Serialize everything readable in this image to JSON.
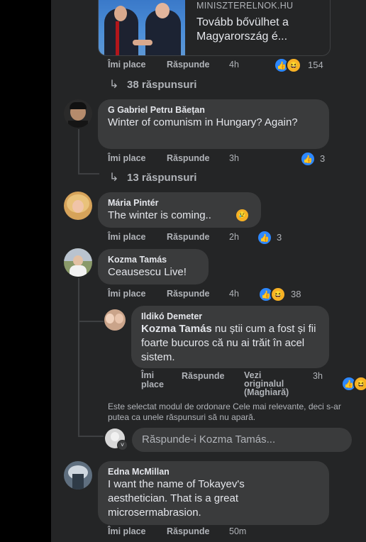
{
  "link_card": {
    "domain": "MINISZTERELNOK.HU",
    "title": "Tovább bővülhet a Magyarország é..."
  },
  "actions": {
    "like": "Îmi place",
    "reply": "Răspunde"
  },
  "comments": [
    {
      "time": "4h",
      "reactions": "154",
      "replies_label": "38 răspunsuri"
    },
    {
      "name": "G Gabriel Petru Băețan",
      "text": "Winter of comunism in Hungary? Again?",
      "time": "3h",
      "reactions": "3",
      "replies_label": "13 răspunsuri"
    },
    {
      "name": "Mária Pintér",
      "text": "The winter is coming..",
      "time": "2h",
      "reactions": "3"
    },
    {
      "name": "Kozma Tamás",
      "text": "Ceausescu Live!",
      "time": "4h",
      "reactions": "38"
    },
    {
      "name": "Edna McMillan",
      "text": "I want the name of Tokayev's aesthetician. That is a great microsermabrasion.",
      "time": "50m"
    }
  ],
  "reply": {
    "name": "Ildikó Demeter",
    "mention": "Kozma Tamás",
    "text": " nu știi cum a fost și fii foarte bucuros că nu ai trăit în acel sistem.",
    "time": "3h",
    "see_original": "Vezi originalul (Maghiară)"
  },
  "sort_notice": "Este selectat modul de ordonare Cele mai relevante, deci s-ar putea ca unele răspunsuri să nu apară.",
  "reply_input": {
    "placeholder": "Răspunde-i Kozma Tamás..."
  },
  "icons": {
    "like": "like-icon",
    "haha": "haha-icon",
    "reply_arrow": "reply-arrow-icon",
    "sad": "sad-emoji-icon"
  },
  "colors": {
    "background": "#18191a",
    "panel": "#242526",
    "bubble": "#3a3b3c",
    "like_blue": "#2d88ff",
    "haha_yellow": "#f7b125"
  }
}
